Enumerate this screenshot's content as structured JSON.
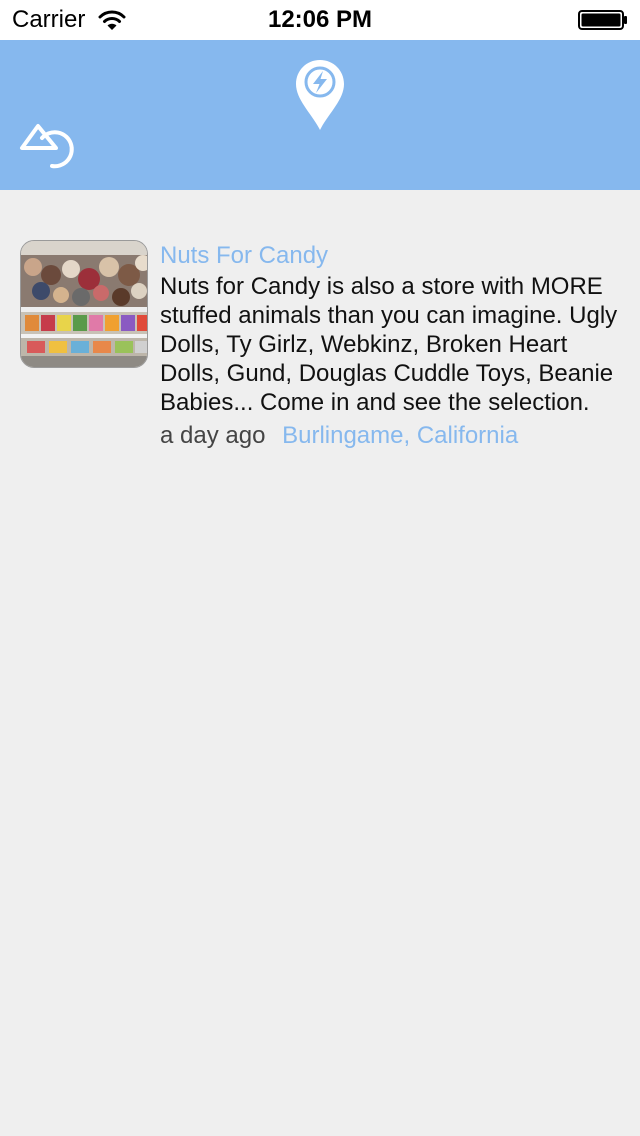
{
  "status_bar": {
    "carrier": "Carrier",
    "time": "12:06 PM"
  },
  "nav": {
    "logo_icon": "location-pin-lightning-icon",
    "back_icon": "back-arrow-circle-icon",
    "background": "#86b8ee"
  },
  "feed": {
    "items": [
      {
        "title": "Nuts For Candy",
        "description": "Nuts for Candy is also a store with MORE stuffed animals than you can imagine. Ugly Dolls, Ty Girlz, Webkinz, Broken Heart Dolls, Gund, Douglas Cuddle Toys, Beanie Babies... Come in and see the selection.",
        "time_ago": "a day ago",
        "location": "Burlingame, California"
      }
    ]
  },
  "colors": {
    "accent": "#86b8ee",
    "background": "#efefef",
    "text": "#111111",
    "muted": "#444444"
  }
}
